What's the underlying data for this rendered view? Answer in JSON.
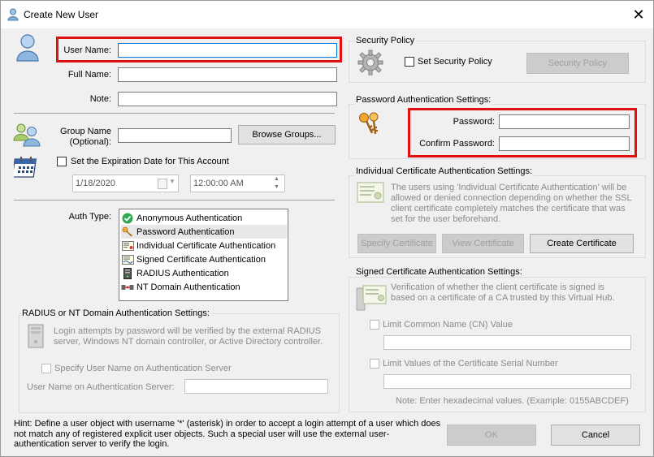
{
  "window": {
    "title": "Create New User",
    "close": "✕"
  },
  "user": {
    "user_name_label": "User Name:",
    "full_name_label": "Full Name:",
    "note_label": "Note:",
    "user_name_value": "",
    "full_name_value": "",
    "note_value": ""
  },
  "group": {
    "label_line1": "Group Name",
    "label_line2": "(Optional):",
    "value": "",
    "browse_button": "Browse Groups..."
  },
  "expiration": {
    "checkbox_label": "Set the Expiration Date for This Account",
    "checked": false,
    "date": "1/18/2020",
    "time": "12:00:00 AM"
  },
  "auth": {
    "label": "Auth Type:",
    "items": [
      {
        "label": "Anonymous Authentication",
        "icon": "check-circle-icon",
        "selected": false
      },
      {
        "label": "Password Authentication",
        "icon": "keys-icon",
        "selected": true
      },
      {
        "label": "Individual Certificate Authentication",
        "icon": "certificate-icon",
        "selected": false
      },
      {
        "label": "Signed Certificate Authentication",
        "icon": "signed-certificate-icon",
        "selected": false
      },
      {
        "label": "RADIUS Authentication",
        "icon": "server-icon",
        "selected": false
      },
      {
        "label": "NT Domain Authentication",
        "icon": "network-icon",
        "selected": false
      }
    ]
  },
  "radius": {
    "title": "RADIUS or NT Domain Authentication Settings:",
    "description": "Login attempts by password will be verified by the external RADIUS server, Windows NT domain controller, or Active Directory controller.",
    "specify_checkbox": "Specify User Name on Authentication Server",
    "server_user_label": "User Name on Authentication Server:",
    "server_user_value": ""
  },
  "security_policy": {
    "title": "Security Policy",
    "checkbox_label": "Set Security Policy",
    "button": "Security Policy"
  },
  "password": {
    "title": "Password Authentication Settings:",
    "password_label": "Password:",
    "confirm_label": "Confirm Password:",
    "password_value": "",
    "confirm_value": ""
  },
  "individual_cert": {
    "title": "Individual Certificate Authentication Settings:",
    "description": "The users using 'Individual Certificate Authentication' will be allowed or denied connection depending on whether the SSL client certificate completely matches the certificate that was set for the user beforehand.",
    "specify_button": "Specify Certificate",
    "view_button": "View Certificate",
    "create_button": "Create Certificate"
  },
  "signed_cert": {
    "title": "Signed Certificate Authentication Settings:",
    "description": "Verification of whether the client certificate is signed is based on a certificate of a CA trusted by this Virtual Hub.",
    "limit_cn_label": "Limit Common Name (CN) Value",
    "limit_cn_value": "",
    "limit_serial_label": "Limit Values of the Certificate Serial Number",
    "limit_serial_value": "",
    "note": "Note: Enter hexadecimal values. (Example: 0155ABCDEF)"
  },
  "hint": "Hint: Define a user object with username '*' (asterisk) in order to accept a login attempt of a user which does not match any of registered explicit user objects. Such a special user will use the external user-authentication server to verify the login.",
  "buttons": {
    "ok": "OK",
    "cancel": "Cancel"
  },
  "colors": {
    "highlight_box": "#e01010",
    "window_bg": "#f0f0f0",
    "focus_border": "#0078d7"
  }
}
